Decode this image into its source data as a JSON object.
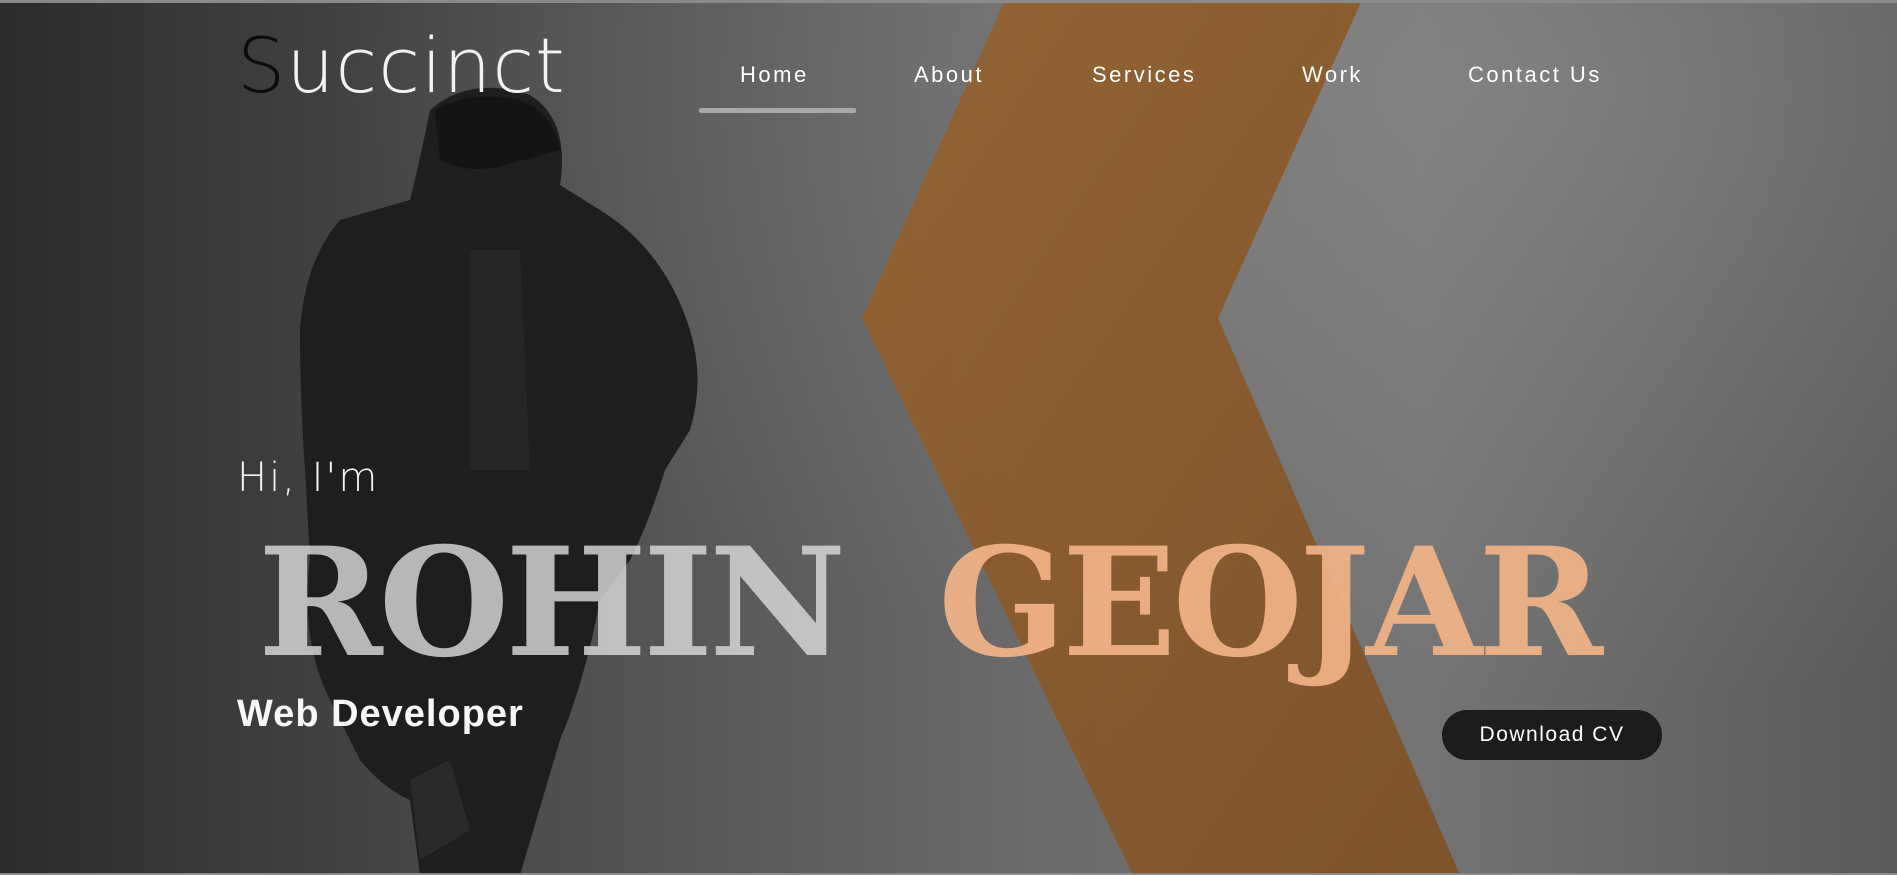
{
  "logo": {
    "first_letter": "S",
    "rest": "uccinct"
  },
  "nav": {
    "items": [
      {
        "label": "Home",
        "active": true
      },
      {
        "label": "About",
        "active": false
      },
      {
        "label": "Services",
        "active": false
      },
      {
        "label": "Work",
        "active": false
      },
      {
        "label": "Contact Us",
        "active": false
      }
    ]
  },
  "hero": {
    "greeting": "Hi, I'm",
    "name_first": "ROHIN",
    "name_last": "GEOJAR",
    "role": "Web Developer",
    "cta_label": "Download CV"
  },
  "colors": {
    "accent_orange": "#f2b388",
    "stripe_orange": "#8a5a2a",
    "button_bg": "#1c1c1c"
  }
}
